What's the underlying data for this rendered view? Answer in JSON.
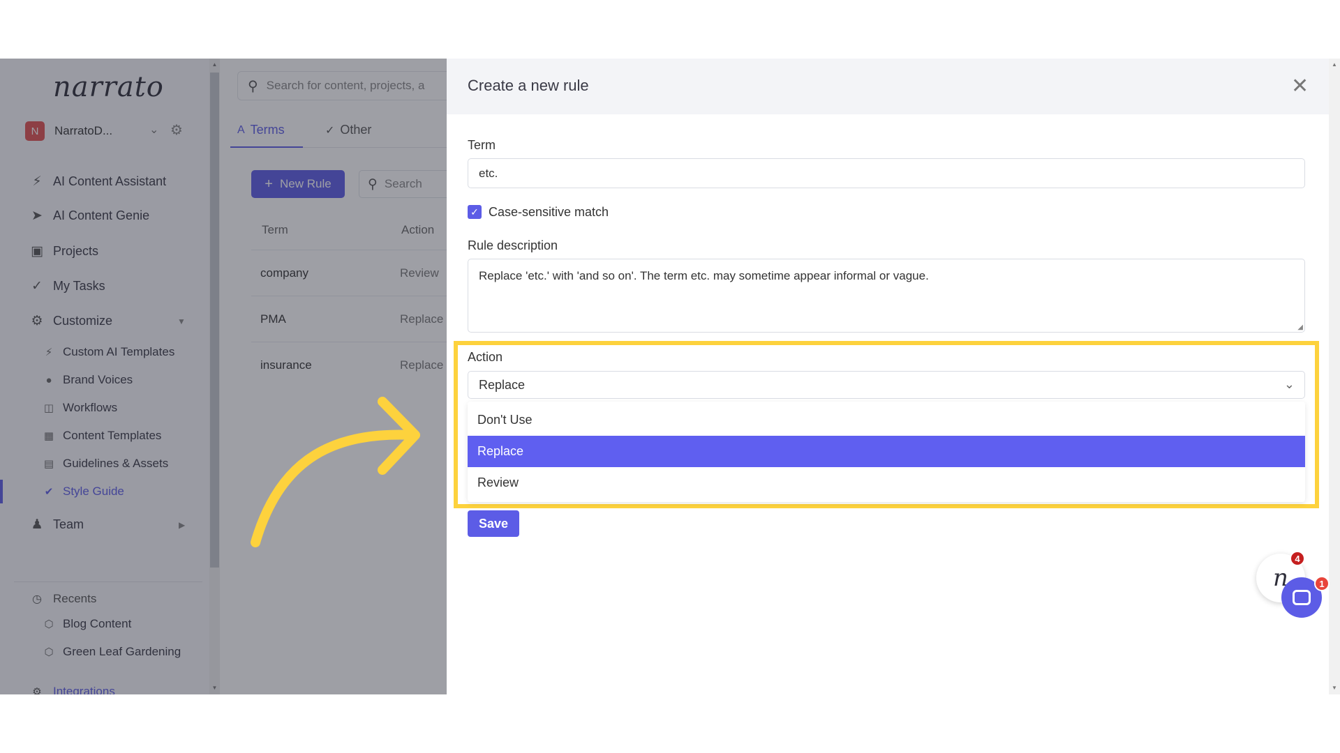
{
  "sidebar": {
    "logo": "narrato",
    "workspace": {
      "initial": "N",
      "name": "NarratoD..."
    },
    "items": [
      {
        "label": "AI Content Assistant",
        "icon": "lightning-icon"
      },
      {
        "label": "AI Content Genie",
        "icon": "rocket-icon"
      },
      {
        "label": "Projects",
        "icon": "briefcase-icon"
      },
      {
        "label": "My Tasks",
        "icon": "checkmark-icon"
      },
      {
        "label": "Customize",
        "icon": "gears-icon"
      }
    ],
    "customize_items": [
      {
        "label": "Custom AI Templates",
        "icon": "lightning-icon"
      },
      {
        "label": "Brand Voices",
        "icon": "microphone-icon"
      },
      {
        "label": "Workflows",
        "icon": "robot-icon"
      },
      {
        "label": "Content Templates",
        "icon": "templates-icon"
      },
      {
        "label": "Guidelines & Assets",
        "icon": "chart-icon"
      },
      {
        "label": "Style Guide",
        "icon": "style-guide-icon"
      }
    ],
    "team_label": "Team",
    "recents_label": "Recents",
    "recents": [
      {
        "label": "Blog Content"
      },
      {
        "label": "Green Leaf Gardening"
      }
    ],
    "integrations_label": "Integrations"
  },
  "middle": {
    "search_placeholder": "Search for content, projects, a",
    "tabs": [
      {
        "label": "Terms"
      },
      {
        "label": "Other"
      }
    ],
    "new_rule_label": "New Rule",
    "search_small_placeholder": "Search",
    "columns": [
      "Term",
      "Action"
    ],
    "rows": [
      {
        "term": "company",
        "action": "Review"
      },
      {
        "term": "PMA",
        "action": "Replace"
      },
      {
        "term": "insurance",
        "action": "Replace"
      }
    ]
  },
  "drawer": {
    "title": "Create a new rule",
    "term_label": "Term",
    "term_value": "etc.",
    "case_sensitive_label": "Case-sensitive match",
    "case_sensitive_checked": true,
    "description_label": "Rule description",
    "description_value": "Replace 'etc.' with 'and so on'. The term etc. may sometime appear informal or vague.",
    "action_label": "Action",
    "action_value": "Replace",
    "options": [
      "Don't Use",
      "Replace",
      "Review"
    ],
    "save_label": "Save"
  },
  "chat": {
    "logo_glyph": "n",
    "badge_count": "4",
    "message_badge": "1"
  },
  "colors": {
    "accent": "#5c5ce6",
    "highlight": "#fdd23d",
    "overlay": "#282a38"
  }
}
